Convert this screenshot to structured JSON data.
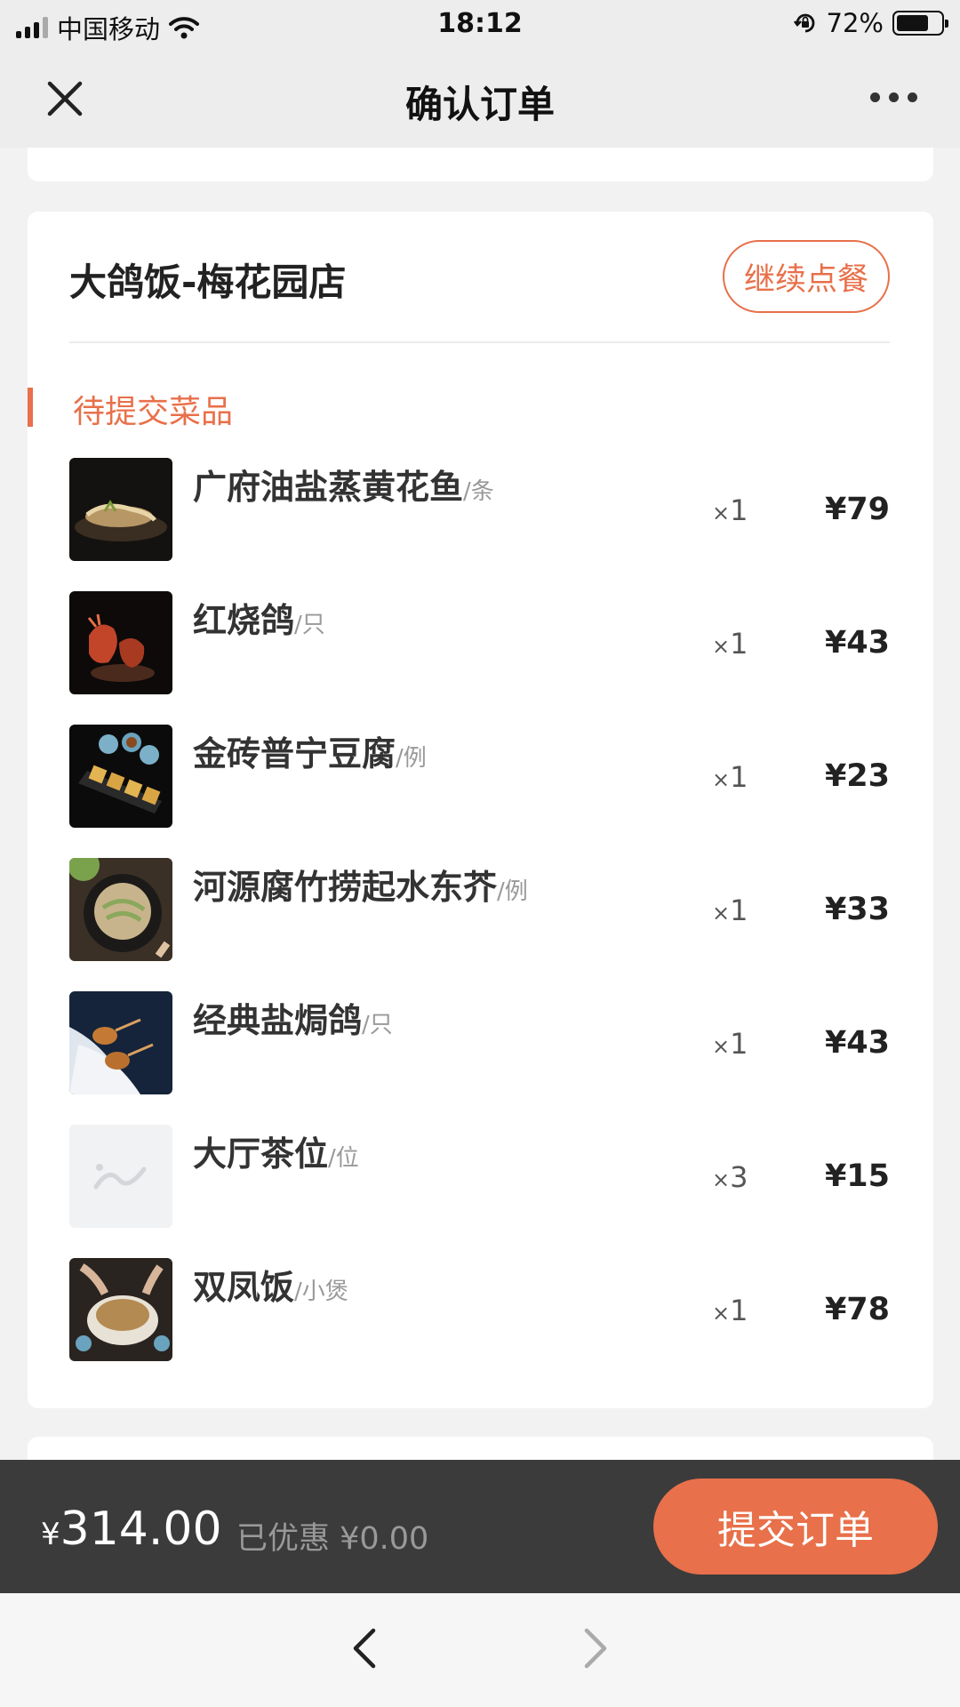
{
  "status_bar": {
    "carrier": "中国移动",
    "time": "18:12",
    "battery": "72%",
    "battery_level": 0.72
  },
  "nav": {
    "title": "确认订单",
    "close_icon": "close-icon",
    "more_icon": "more-icon"
  },
  "shop": {
    "name": "大鸽饭-梅花园店",
    "continue_label": "继续点餐"
  },
  "section": {
    "title": "待提交菜品"
  },
  "items": [
    {
      "name": "广府油盐蒸黄花鱼",
      "unit": "/条",
      "qty": "1",
      "price": "¥79",
      "thumb": "fish"
    },
    {
      "name": "红烧鸽",
      "unit": "/只",
      "qty": "1",
      "price": "¥43",
      "thumb": "pigeon"
    },
    {
      "name": "金砖普宁豆腐",
      "unit": "/例",
      "qty": "1",
      "price": "¥23",
      "thumb": "tofu"
    },
    {
      "name": "河源腐竹捞起水东芥",
      "unit": "/例",
      "qty": "1",
      "price": "¥33",
      "thumb": "salad"
    },
    {
      "name": "经典盐焗鸽",
      "unit": "/只",
      "qty": "1",
      "price": "¥43",
      "thumb": "salt-pigeon"
    },
    {
      "name": "大厅茶位",
      "unit": "/位",
      "qty": "3",
      "price": "¥15",
      "thumb": "placeholder"
    },
    {
      "name": "双凤饭",
      "unit": "/小煲",
      "qty": "1",
      "price": "¥78",
      "thumb": "rice"
    }
  ],
  "qty_prefix": "×",
  "footer": {
    "currency": "¥",
    "total": "314.00",
    "discount": "已优惠 ¥0.00",
    "submit_label": "提交订单"
  },
  "colors": {
    "accent": "#e8704a",
    "footer_bg": "#3b3b3b"
  }
}
